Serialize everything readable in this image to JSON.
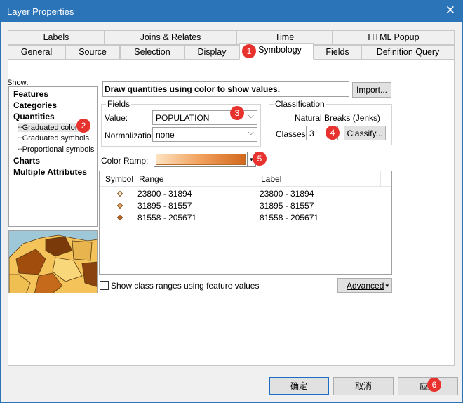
{
  "window": {
    "title": "Layer Properties",
    "close_glyph": "✕"
  },
  "tabs_row1": [
    "Labels",
    "Joins & Relates",
    "Time",
    "HTML Popup"
  ],
  "tabs_row2": [
    "General",
    "Source",
    "Selection",
    "Display",
    "Symbology",
    "Fields",
    "Definition Query"
  ],
  "active_tab": "Symbology",
  "show": {
    "label": "Show:",
    "items": [
      "Features",
      "Categories",
      "Quantities",
      "Graduated colors",
      "Graduated symbols",
      "Proportional symbols",
      "Charts",
      "Multiple Attributes"
    ],
    "selected": "Graduated colors"
  },
  "description": "Draw quantities using color to show values.",
  "import_label": "Import...",
  "fields": {
    "caption": "Fields",
    "value_label": "Value:",
    "value": "POPULATION",
    "normalization_label": "Normalization:",
    "normalization": "none"
  },
  "classification": {
    "caption": "Classification",
    "method": "Natural Breaks (Jenks)",
    "classes_label": "Classes:",
    "classes": "3",
    "classify_label": "Classify..."
  },
  "color_ramp_label": "Color Ramp:",
  "color_ramp_colors": [
    "#fde2c0",
    "#f1a05c",
    "#d2691e"
  ],
  "table": {
    "headers": [
      "Symbol",
      "Range",
      "Label"
    ],
    "rows": [
      {
        "range": "23800 - 31894",
        "label": "23800 - 31894",
        "color": "#fbe5c8"
      },
      {
        "range": "31895 - 81557",
        "label": "31895 - 81557",
        "color": "#e9a560"
      },
      {
        "range": "81558 - 205671",
        "label": "81558 - 205671",
        "color": "#c2621c"
      }
    ]
  },
  "show_class_ranges_label": "Show class ranges using feature values",
  "advanced_label": "Advanced",
  "buttons": {
    "ok": "确定",
    "cancel": "取消",
    "apply": "应用"
  },
  "badges": [
    "1",
    "2",
    "3",
    "4",
    "5",
    "6"
  ]
}
